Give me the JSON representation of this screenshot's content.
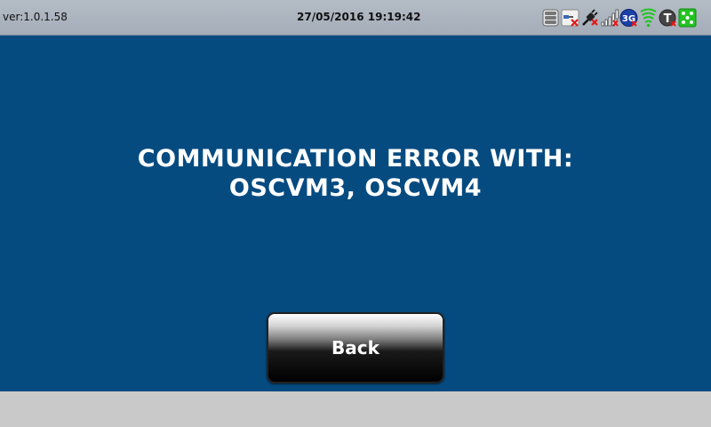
{
  "status_bar": {
    "version": "ver:1.0.1.58",
    "datetime": "27/05/2016 19:19:42",
    "icons": [
      "database-icon",
      "network-disconnected-icon",
      "plug-icon",
      "signal-strength-icon",
      "3g-icon",
      "wifi-icon",
      "t-service-icon",
      "app-grid-icon"
    ],
    "icon_3g_label": "3G",
    "icon_t_label": "T"
  },
  "main": {
    "error_line1": "COMMUNICATION ERROR WITH:",
    "error_line2": "OSCVM3, OSCVM4",
    "back_label": "Back"
  },
  "colors": {
    "background": "#064b80",
    "status_bar": "#aab2bc",
    "bottom_bar": "#c9c9c9",
    "error_accent": "#e01818",
    "green_accent": "#22c322"
  }
}
